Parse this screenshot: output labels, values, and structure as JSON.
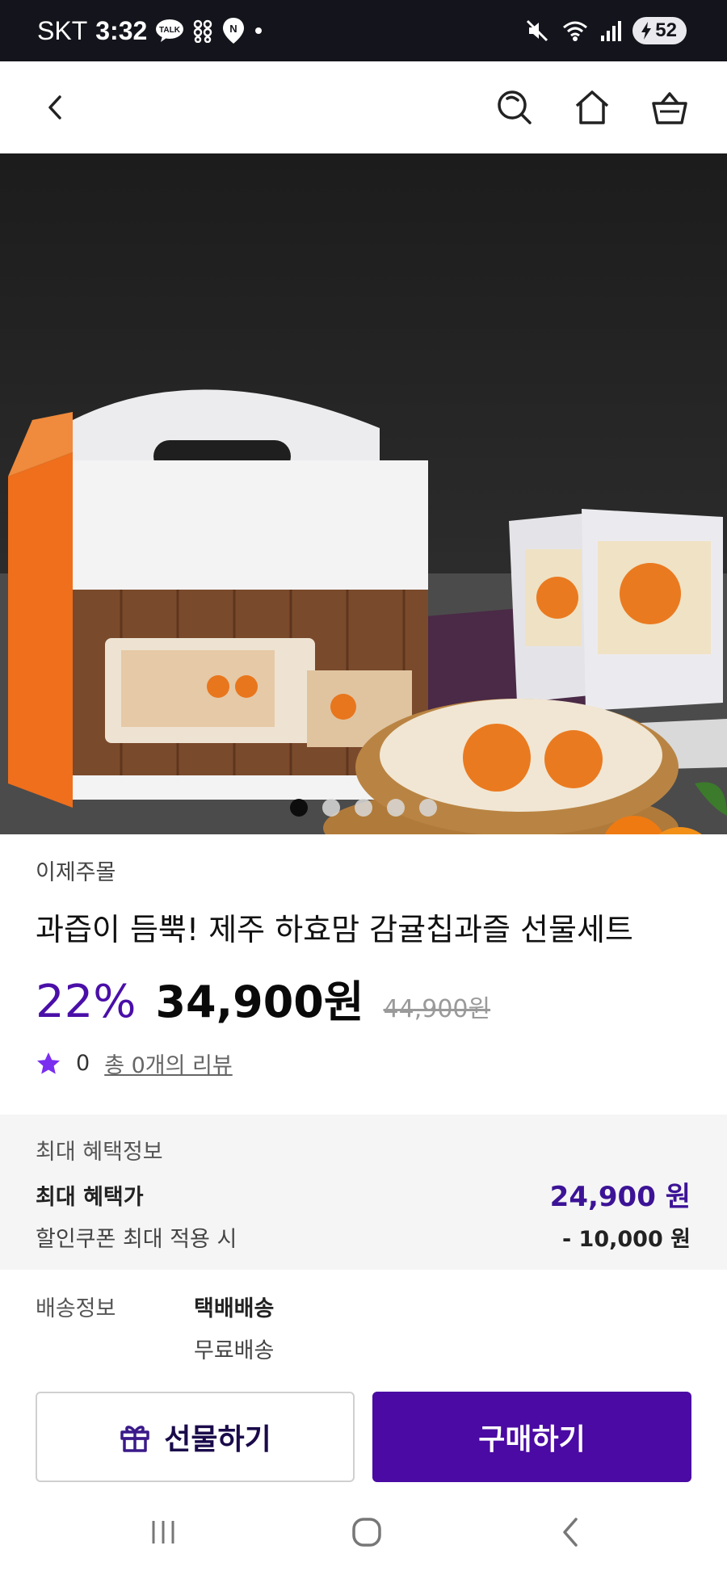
{
  "status_bar": {
    "carrier": "SKT",
    "time": "3:32",
    "talk_badge": "TALK",
    "naver_badge": "N",
    "battery": "52"
  },
  "nav": {
    "icons": [
      "back-icon",
      "search-icon",
      "home-icon",
      "cart-icon"
    ]
  },
  "carousel": {
    "slide_count": 5,
    "active_index": 0
  },
  "product": {
    "seller": "이제주몰",
    "title": "과즙이 듬뿍! 제주 하효맘 감귤칩과즐 선물세트",
    "discount": "22%",
    "price": "34,900원",
    "original_price": "44,900원",
    "rating": "0",
    "review_link": "총 0개의 리뷰"
  },
  "benefit": {
    "header": "최대 혜택정보",
    "max_label": "최대 혜택가",
    "max_value": "24,900 원",
    "coupon_label": "할인쿠폰 최대 적용 시",
    "coupon_value": "- 10,000 원"
  },
  "delivery": {
    "label": "배송정보",
    "type": "택배배송",
    "fee": "무료배송"
  },
  "actions": {
    "gift": "선물하기",
    "buy": "구매하기"
  },
  "colors": {
    "accent": "#4a0aa3",
    "discount": "#4a0fa8",
    "benefit_price": "#3c1396",
    "status_bar_bg": "#14151c"
  }
}
